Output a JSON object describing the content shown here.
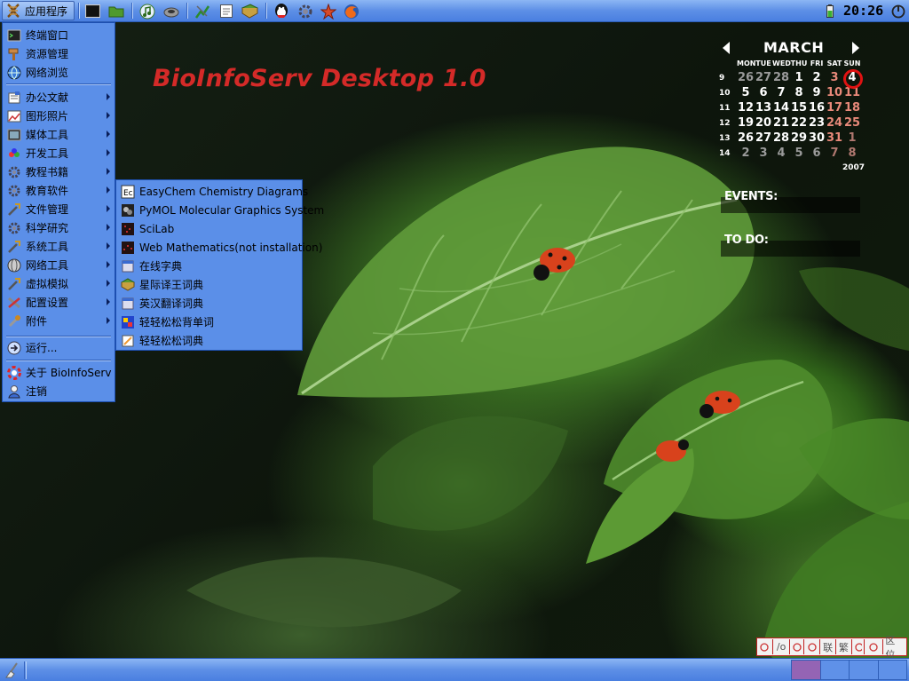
{
  "top_panel": {
    "apps_menu_label": "应用程序",
    "clock": "20:26",
    "launchers": [
      {
        "icon": "terminal-icon"
      },
      {
        "icon": "folder-icon"
      },
      {
        "icon": "music-player-icon"
      },
      {
        "icon": "disc-burner-icon"
      },
      {
        "icon": "chart-tool-icon"
      },
      {
        "icon": "text-editor-icon"
      },
      {
        "icon": "books-icon"
      },
      {
        "icon": "qq-penguin-icon"
      },
      {
        "icon": "gear-icon"
      },
      {
        "icon": "star-tool-icon"
      },
      {
        "icon": "firefox-icon"
      }
    ],
    "tray": [
      {
        "icon": "battery-icon"
      },
      {
        "icon": "power-icon"
      }
    ]
  },
  "desktop": {
    "title": "BioInfoServ Desktop 1.0"
  },
  "main_menu": {
    "items": [
      {
        "label": "终端窗口",
        "icon": "terminal-icon",
        "submenu": false
      },
      {
        "label": "资源管理",
        "icon": "hammer-icon",
        "submenu": false
      },
      {
        "label": "网络浏览",
        "icon": "globe-icon",
        "submenu": false
      },
      {
        "label": "办公文献",
        "icon": "office-icon",
        "submenu": true
      },
      {
        "label": "图形照片",
        "icon": "graphics-icon",
        "submenu": true
      },
      {
        "label": "媒体工具",
        "icon": "media-icon",
        "submenu": true
      },
      {
        "label": "开发工具",
        "icon": "development-icon",
        "submenu": true
      },
      {
        "label": "教程书籍",
        "icon": "gear-icon",
        "submenu": true
      },
      {
        "label": "教育软件",
        "icon": "gear-icon",
        "submenu": true
      },
      {
        "label": "文件管理",
        "icon": "tools-icon",
        "submenu": true
      },
      {
        "label": "科学研究",
        "icon": "gear-icon",
        "submenu": true
      },
      {
        "label": "系统工具",
        "icon": "tools-icon",
        "submenu": true
      },
      {
        "label": "网络工具",
        "icon": "network-icon",
        "submenu": true
      },
      {
        "label": "虚拟模拟",
        "icon": "tools-icon",
        "submenu": true
      },
      {
        "label": "配置设置",
        "icon": "settings-icon",
        "submenu": true
      },
      {
        "label": "附件",
        "icon": "accessories-icon",
        "submenu": true
      }
    ],
    "run_label": "运行...",
    "about_label": "关于 BioInfoServ",
    "logout_label": "注销"
  },
  "sub_menu": {
    "items": [
      {
        "label": "EasyChem Chemistry Diagrams",
        "icon": "easychem-icon"
      },
      {
        "label": "PyMOL Molecular Graphics System",
        "icon": "pymol-icon"
      },
      {
        "label": "SciLab",
        "icon": "scilab-icon"
      },
      {
        "label": "Web Mathematics(not installation)",
        "icon": "web-math-icon"
      },
      {
        "label": "在线字典",
        "icon": "document-icon"
      },
      {
        "label": "星际译王词典",
        "icon": "books-icon"
      },
      {
        "label": "英汉翻译词典",
        "icon": "document-icon"
      },
      {
        "label": "轻轻松松背单词",
        "icon": "flashcard-icon"
      },
      {
        "label": "轻轻松松词典",
        "icon": "dictionary-icon"
      }
    ]
  },
  "calendar": {
    "month": "MARCH",
    "year": "2007",
    "weekdays": [
      "MON",
      "TUE",
      "WED",
      "THU",
      "FRI",
      "SAT",
      "SUN"
    ],
    "weeks": [
      {
        "week": "9",
        "days": [
          "26",
          "27",
          "28",
          "1",
          "2",
          "3",
          "4"
        ]
      },
      {
        "week": "10",
        "days": [
          "5",
          "6",
          "7",
          "8",
          "9",
          "10",
          "11"
        ]
      },
      {
        "week": "11",
        "days": [
          "12",
          "13",
          "14",
          "15",
          "16",
          "17",
          "18"
        ]
      },
      {
        "week": "12",
        "days": [
          "19",
          "20",
          "21",
          "22",
          "23",
          "24",
          "25"
        ]
      },
      {
        "week": "13",
        "days": [
          "26",
          "27",
          "28",
          "29",
          "30",
          "31",
          "1"
        ]
      },
      {
        "week": "14",
        "days": [
          "2",
          "3",
          "4",
          "5",
          "6",
          "7",
          "8"
        ]
      }
    ],
    "today": "4"
  },
  "events": {
    "label": "EVENTS:"
  },
  "todo": {
    "label": "TO DO:"
  },
  "ime_bar": {
    "items": [
      {
        "icon": "linux-penguin-icon",
        "text": ""
      },
      {
        "icon": "input-mode-icon",
        "text": "/o"
      },
      {
        "icon": "pen-icon",
        "text": ""
      },
      {
        "icon": "punctuation-icon",
        "text": ""
      },
      {
        "icon": "lianxiang-icon",
        "text": "联"
      },
      {
        "icon": "traditional-icon",
        "text": "繁"
      },
      {
        "icon": "lock-icon",
        "text": ""
      },
      {
        "icon": "keyboard-icon",
        "text": ""
      },
      {
        "icon": "region-icon",
        "text": "区位"
      }
    ]
  },
  "bottom_panel": {
    "workspaces": [
      "1",
      "2",
      "3",
      "4"
    ],
    "active_workspace": "1"
  },
  "colors": {
    "panel_blue": "#5d8fe6",
    "menu_blue": "#5b8fe8",
    "title_red": "#d42a28",
    "active_workspace": "#9464b4",
    "today_ring": "#e01212"
  }
}
